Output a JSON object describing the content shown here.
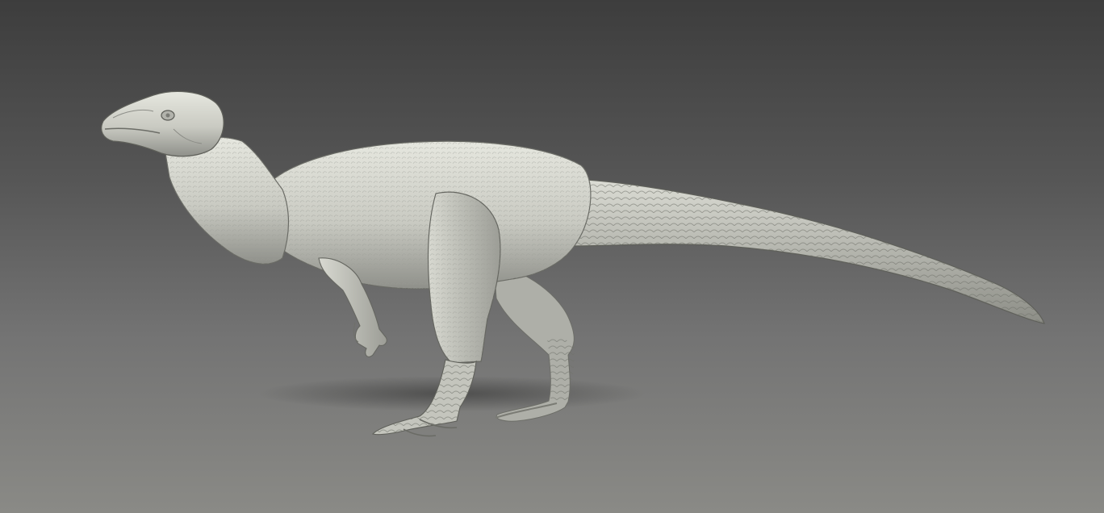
{
  "scene": {
    "subject": "dinosaur-sculpt",
    "background_top": "#3d3d3d",
    "background_bottom": "#8a8a86",
    "skin_light": "#e3e4dc",
    "skin_mid": "#b9bab2",
    "skin_dark": "#7e7f78",
    "shadow_color": "#2e2e2e"
  }
}
